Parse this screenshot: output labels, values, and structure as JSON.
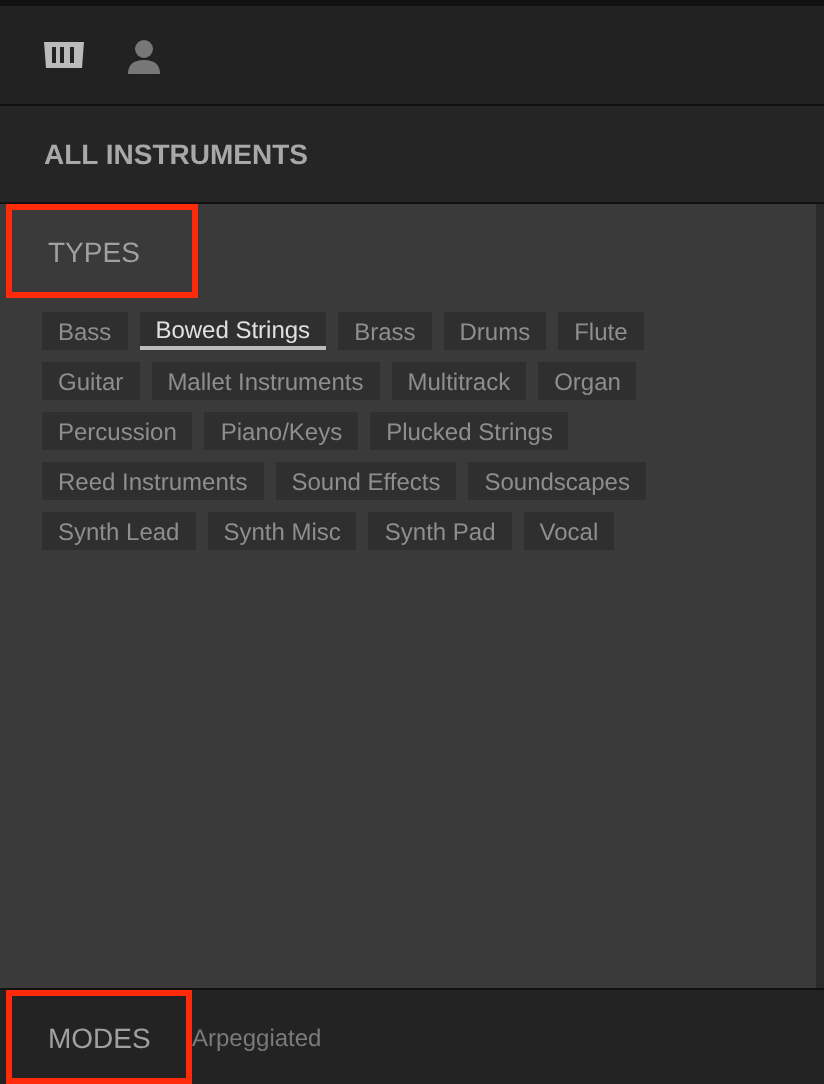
{
  "header": {
    "title": "ALL INSTRUMENTS"
  },
  "types": {
    "title": "TYPES",
    "highlighted": true,
    "tags": [
      [
        {
          "label": "Bass",
          "selected": false
        },
        {
          "label": "Bowed Strings",
          "selected": true
        },
        {
          "label": "Brass",
          "selected": false
        },
        {
          "label": "Drums",
          "selected": false
        },
        {
          "label": "Flute",
          "selected": false
        }
      ],
      [
        {
          "label": "Guitar",
          "selected": false
        },
        {
          "label": "Mallet Instruments",
          "selected": false
        },
        {
          "label": "Multitrack",
          "selected": false
        },
        {
          "label": "Organ",
          "selected": false
        }
      ],
      [
        {
          "label": "Percussion",
          "selected": false
        },
        {
          "label": "Piano/Keys",
          "selected": false
        },
        {
          "label": "Plucked Strings",
          "selected": false
        }
      ],
      [
        {
          "label": "Reed Instruments",
          "selected": false
        },
        {
          "label": "Sound Effects",
          "selected": false
        },
        {
          "label": "Soundscapes",
          "selected": false
        }
      ],
      [
        {
          "label": "Synth Lead",
          "selected": false
        },
        {
          "label": "Synth Misc",
          "selected": false
        },
        {
          "label": "Synth Pad",
          "selected": false
        },
        {
          "label": "Vocal",
          "selected": false
        }
      ]
    ]
  },
  "modes": {
    "title": "MODES",
    "highlighted": true,
    "items": [
      {
        "label": "Arpeggiated",
        "selected": false
      }
    ]
  }
}
